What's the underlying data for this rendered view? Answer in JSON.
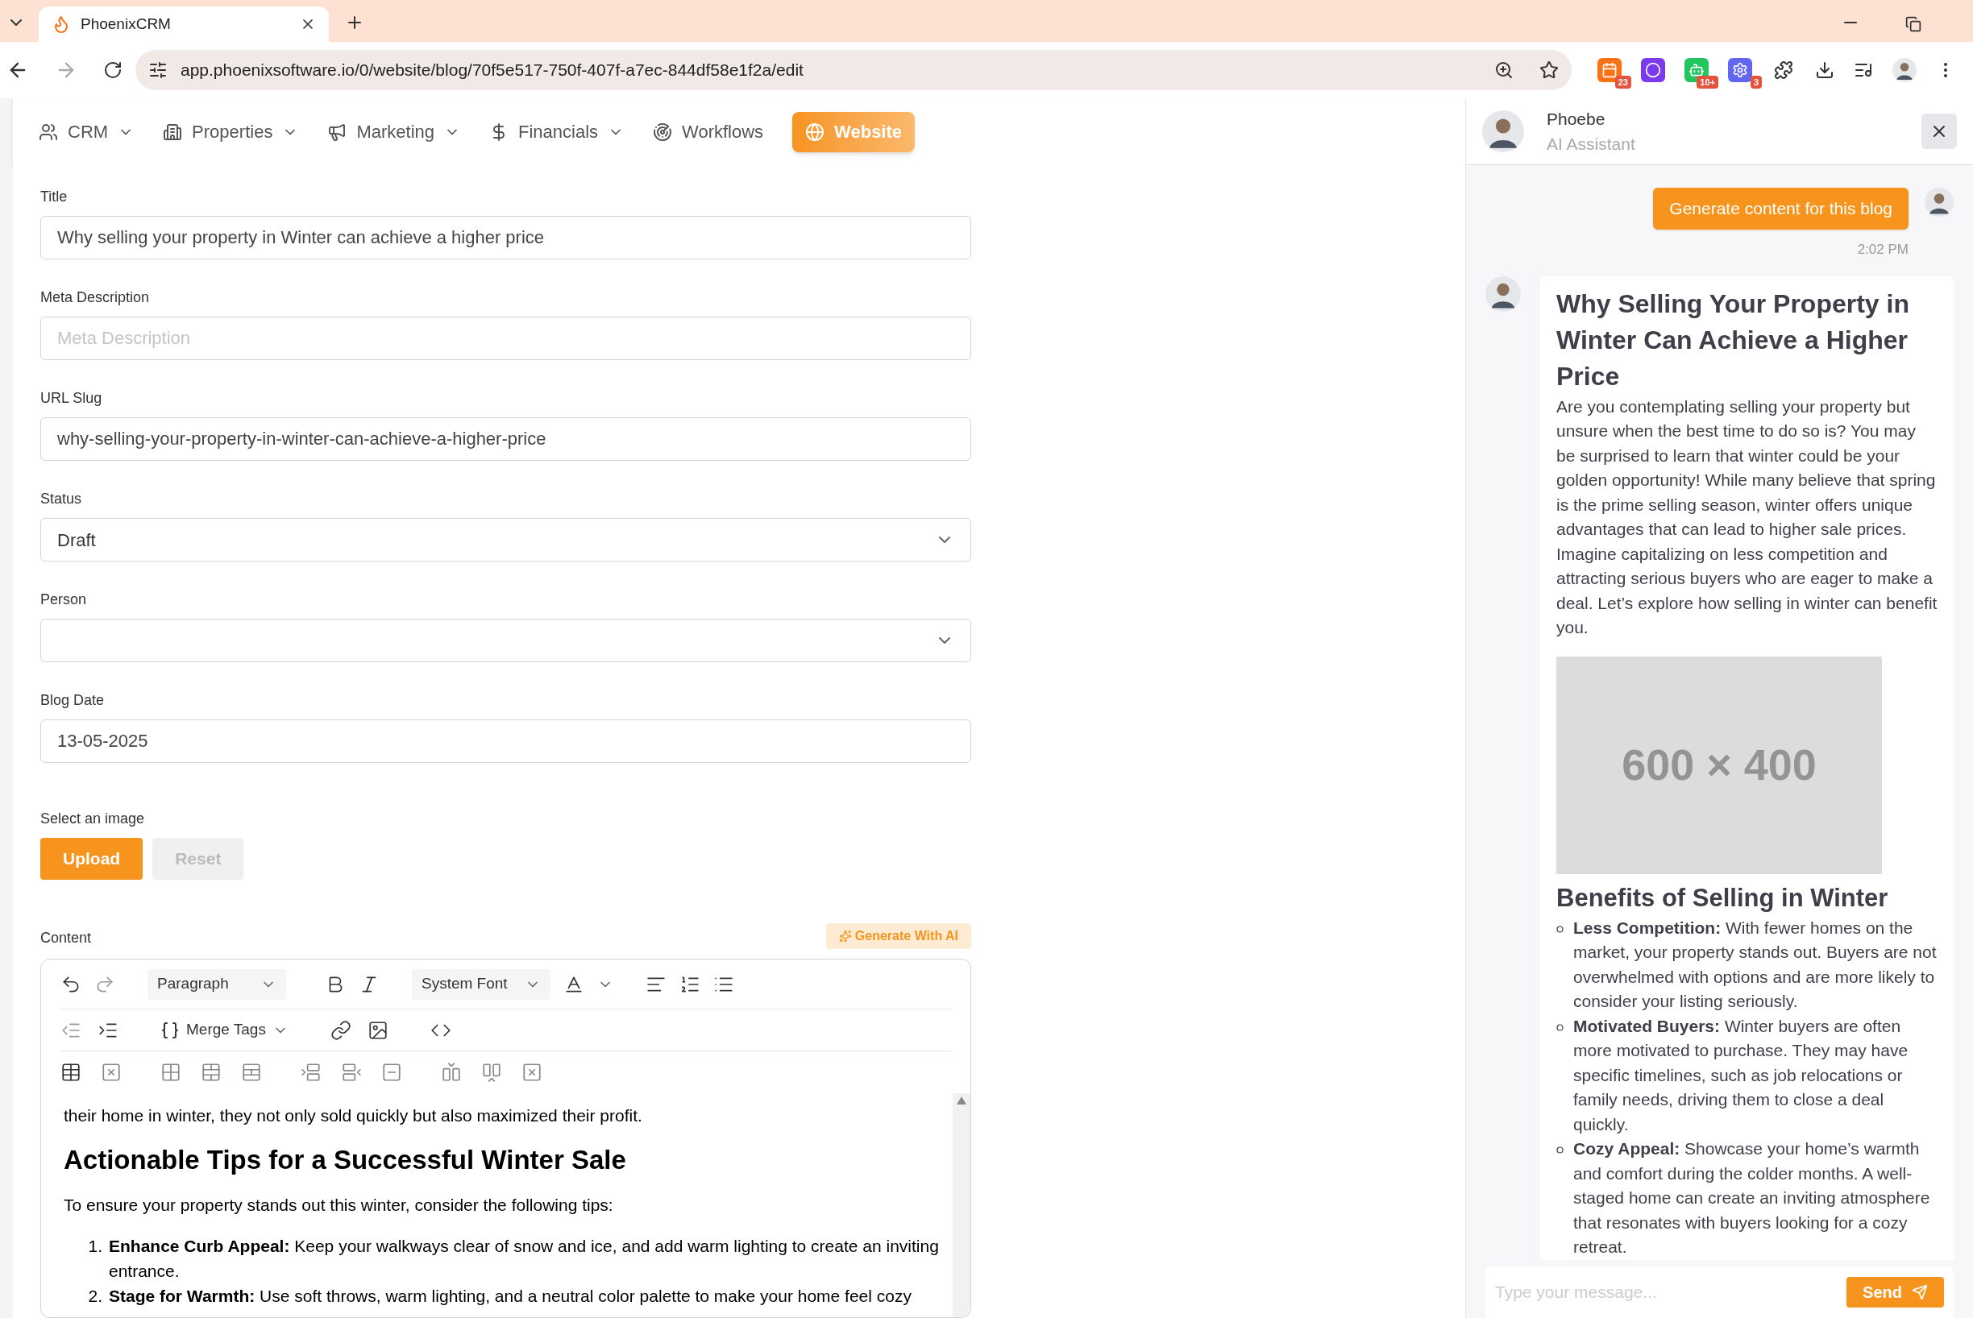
{
  "browser": {
    "tab_title": "PhoenixCRM",
    "url": "app.phoenixsoftware.io/0/website/blog/70f5e517-750f-407f-a7ec-844df58e1f2a/edit",
    "extensions": [
      {
        "kind": "calendar",
        "badge": "23"
      },
      {
        "kind": "ring"
      },
      {
        "kind": "robot",
        "badge": "10+"
      },
      {
        "kind": "gear",
        "badge": "3"
      },
      {
        "kind": "puzzle"
      }
    ]
  },
  "nav": [
    {
      "label": "CRM",
      "kind": "people",
      "has_menu": true,
      "selected": false
    },
    {
      "label": "Properties",
      "kind": "building",
      "has_menu": true,
      "selected": false
    },
    {
      "label": "Marketing",
      "kind": "megaphone",
      "has_menu": true,
      "selected": false
    },
    {
      "label": "Financials",
      "kind": "dollar",
      "has_menu": true,
      "selected": false
    },
    {
      "label": "Workflows",
      "kind": "workflow",
      "has_menu": false,
      "selected": false
    },
    {
      "label": "Website",
      "kind": "globe",
      "has_menu": false,
      "selected": true
    }
  ],
  "fields": [
    {
      "label": "Title",
      "kind": "text",
      "value": "Why selling your property in Winter can achieve a higher price"
    },
    {
      "label": "Meta Description",
      "kind": "text",
      "placeholder": "Meta Description"
    },
    {
      "label": "URL Slug",
      "kind": "text",
      "value": "why-selling-your-property-in-winter-can-achieve-a-higher-price"
    },
    {
      "label": "Status",
      "kind": "select",
      "value": "Draft"
    },
    {
      "label": "Person",
      "kind": "select"
    },
    {
      "label": "Blog Date",
      "kind": "text",
      "value": "13-05-2025"
    }
  ],
  "image": {
    "label": "Select an image",
    "buttons": [
      {
        "label": "Upload",
        "disabled": false
      },
      {
        "label": "Reset",
        "disabled": true
      }
    ]
  },
  "content": {
    "label": "Content",
    "generate_button": "Generate With AI",
    "toolbar": {
      "block_format": "Paragraph",
      "font": "System Font",
      "merge_tags": "Merge Tags"
    },
    "body": [
      {
        "kind": "paragraph",
        "text": "their home in winter, they not only sold quickly but also maximized their profit."
      },
      {
        "kind": "heading",
        "text": "Actionable Tips for a Successful Winter Sale"
      },
      {
        "kind": "paragraph",
        "text": "To ensure your property stands out this winter, consider the following tips:"
      },
      {
        "kind": "ordered_list",
        "items": [
          {
            "number": "1.",
            "text": "**Enhance Curb Appeal:** Keep your walkways clear of snow and ice, and add warm lighting to create an inviting entrance."
          },
          {
            "number": "2.",
            "text": "**Stage for Warmth:** Use soft throws, warm lighting, and a neutral color palette to make your home feel cozy"
          }
        ]
      }
    ]
  },
  "chat": {
    "name": "Phoebe",
    "role": "AI Assistant",
    "user_message": "Generate content for this blog",
    "time": "2:02 PM",
    "reply": [
      {
        "kind": "heading",
        "text": "Why Selling Your Property in Winter Can Achieve a Higher Price"
      },
      {
        "kind": "paragraph",
        "text": "Are you contemplating selling your property but unsure when the best time to do so is? You may be surprised to learn that winter could be your golden opportunity! While many believe that spring is the prime selling season, winter offers unique advantages that can lead to higher sale prices. Imagine capitalizing on less competition and attracting serious buyers who are eager to make a deal. Let’s explore how selling in winter can benefit you."
      },
      {
        "kind": "image",
        "text": "600 × 400"
      },
      {
        "kind": "subheading",
        "text": "Benefits of Selling in Winter"
      },
      {
        "kind": "bullet_list",
        "items": [
          "**Less Competition:** With fewer homes on the market, your property stands out. Buyers are not overwhelmed with options and are more likely to consider your listing seriously.",
          "**Motivated Buyers:** Winter buyers are often more motivated to purchase. They may have specific timelines, such as job relocations or family needs, driving them to close a deal quickly.",
          "**Cozy Appeal:** Showcase your home’s warmth and comfort during the colder months. A well-staged home can create an inviting atmosphere that resonates with buyers looking for a cozy retreat."
        ]
      }
    ],
    "input_placeholder": "Type your message...",
    "send_button": "Send"
  }
}
